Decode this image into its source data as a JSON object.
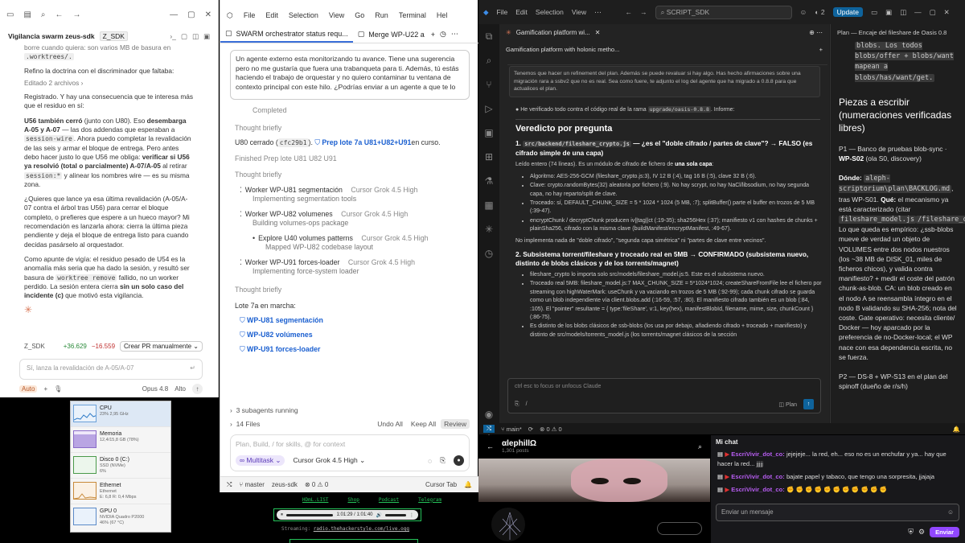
{
  "win1": {
    "title": "Vigilancia swarm zeus-sdk",
    "tag": "Z_SDK",
    "frag1": "borre cuando quiera: son varios MB de basura en",
    "frag2": ".worktrees/.",
    "p_refine": "Refino la doctrina con el discriminador que faltaba:",
    "edited": "Editado 2 archivos",
    "p_registrado": "Registrado. Y hay una consecuencia que te interesa más que el residuo en sí:",
    "u56_bold": "U56 también cerró",
    "u56_a": " (junto con U80). Eso ",
    "u56_b": "desembarga A-05 y A-07",
    "u56_c": " — las dos addendas que esperaban a ",
    "u56_code": "session-wire",
    "u56_d": ". Ahora puedo completar la revalidación de las seis y armar el bloque de entrega. Pero antes debo hacer justo lo que U56 me obliga: ",
    "u56_e": "verificar si U56 ya resolvió (total o parcialmente) A-07/A-05",
    "u56_f": " al retirar ",
    "u56_code2": "session:*",
    "u56_g": " y alinear los nombres wire — es su misma zona.",
    "p_quieres": "¿Quieres que lance ya esa última revalidación (A-05/A-07 contra el árbol tras U56) para cerrar el bloque completo, o prefieres que espere a un hueco mayor? Mi recomendación es lanzarla ahora: cierra la última pieza pendiente y deja el bloque de entrega listo para cuando decidas pasárselo al orquestador.",
    "vig_a": "Como apunte de vigía: el residuo pesado de U54 es la anomalía más seria que ha dado la sesión, y resultó ser basura de ",
    "vig_code": "worktree remove",
    "vig_b": " fallido, no un worker perdido. La sesión entera cierra ",
    "vig_c": "sin un solo caso del incidente (c)",
    "vig_d": " que motivó esta vigilancia.",
    "pr_tag": "Z_SDK",
    "pr_add": "+36.629",
    "pr_del": "−16.559",
    "pr_btn": "Crear PR manualmente",
    "input_placeholder": "Sí, lanza la revalidación de A-05/A-07",
    "mode": "Auto",
    "model": "Opus 4.8",
    "effort": "Alto"
  },
  "tm": {
    "items": [
      {
        "label": "CPU",
        "sub": "23% 2,95 GHz"
      },
      {
        "label": "Memoria",
        "sub": "12,4/15,8 GB (78%)"
      },
      {
        "label": "Disco 0 (C:)",
        "sub": "SSD (NVMe)\n6%"
      },
      {
        "label": "Ethernet",
        "sub": "Ethernet\nE: 6,8 R: 0,4 Mbps"
      },
      {
        "label": "GPU 0",
        "sub": "NVIDIA Quadro P2000\n46% (67 °C)"
      }
    ]
  },
  "win2": {
    "menu": [
      "File",
      "Edit",
      "Selection",
      "View",
      "Go",
      "Run",
      "Terminal",
      "Hel"
    ],
    "tab1": "SWARM orchestrator status requ...",
    "tab2": "Merge WP-U22 a",
    "sugg": "Un agente externo esta monitorizando tu avance. Tiene una sugerencia pero no me gustaría que fuera una trabanqueta para ti. Además, tú estás haciendo el trabajo de orquestar y no quiero contaminar tu ventana de contexto principal con este hilo. ¿Podrías enviar a un agente a que te lo",
    "completed": "Completed",
    "thought": "Thought",
    "briefly": "briefly",
    "u80": "U80 cerrado (",
    "u80_code": "cfc29b1",
    "u80_close": ").",
    "prep": "Prep lote 7a U81+U82+U91",
    "prep_tail": " en curso.",
    "finished_a": "Finished",
    "finished_b": "Prep lote U81 U82 U91",
    "agents": [
      {
        "title": "Worker WP-U81 segmentación",
        "model": "Cursor Grok 4.5 High",
        "sub": "Implementing segmentation tools"
      },
      {
        "title": "Worker WP-U82 volumenes",
        "model": "Cursor Grok 4.5 High",
        "sub": "Building volumes-ops package"
      },
      {
        "title": "Explore U40 volumes patterns",
        "model": "Cursor Grok 4.5 High",
        "sub": "Mapped WP-U82 codebase layout"
      },
      {
        "title": "Worker WP-U91 forces-loader",
        "model": "Cursor Grok 4.5 High",
        "sub": "Implementing force-system loader"
      }
    ],
    "lote": "Lote 7a en marcha:",
    "lote_items": [
      "WP-U81 segmentación",
      "WP-U82 volúmenes",
      "WP-U91 forces-loader"
    ],
    "subagents": "3 subagents running",
    "files": "14 Files",
    "undo": "Undo All",
    "keep": "Keep All",
    "review": "Review",
    "prompt_placeholder": "Plan, Build, / for skills, @ for context",
    "mode": "Multitask",
    "model": "Cursor Grok 4.5 High",
    "status": [
      "master",
      "zeus-sdk",
      "0",
      "0",
      "Cursor Tab"
    ]
  },
  "win3": {
    "menu": [
      "File",
      "Edit",
      "Selection",
      "View"
    ],
    "search": "SCRIPT_SDK",
    "update": "Update",
    "tab": "Gamification platform wi...",
    "heading": "Gamification platform with holonic metho...",
    "intro": "Tenemos que hacer un refinement del plan. Además se puede revaluar si hay algo. Has hecho afirmaciones sobre una migración rara a ssbv2 que no es real. Sea como fuere, te adjunto el log del agente que ha migrado a 0.8.8 para que actualices el plan.",
    "verified": "He verificado todo contra el código real de la rama ",
    "verified_code": "upgrade/oasis-0.8.8",
    "verified_b": ". Informe:",
    "veredicto": "Veredicto por pregunta",
    "q1_code": "src/backend/fileshare_crypto.js",
    "q1": " — ¿es el \"doble cifrado / partes de clave\"? → FALSO (es cifrado simple de una capa)",
    "q1_read": "Leído entero (74 líneas). Es un módulo de cifrado de fichero de ",
    "q1_read_b": "una sola capa",
    "q1_items": [
      "Algoritmo: AES-256-GCM (fileshare_crypto.js:3), IV 12 B (:4), tag 16 B (:5), clave 32 B (:6).",
      "Clave: crypto.randomBytes(32) aleatoria por fichero (:9). No hay scrypt, no hay NaCl/libsodium, no hay segunda capa, no hay reparto/split de clave.",
      "Troceado: sí, DEFAULT_CHUNK_SIZE = 5 * 1024 * 1024 (5 MB, :7); splitBuffer() parte el buffer en trozos de 5 MB (:39-47).",
      "encryptChunk / decryptChunk producen iv||tag||ct (:19-35); sha256Hex (:37); manifiesto v1 con hashes de chunks + plainSha256, cifrado con la misma clave (buildManifest/encryptManifest, :49-67)."
    ],
    "q1_foot": "No implementa nada de \"doble cifrado\", \"segunda capa simétrica\" ni \"partes de clave entre vecinos\".",
    "q2": "2. Subsistema torrent/fileshare y troceado real en 5MB → CONFIRMADO (subsistema nuevo, distinto de blobs clásicos y de los torrents/magnet)",
    "q2_items": [
      "fileshare_crypto lo importa solo src/models/fileshare_model.js:5. Este es el subsistema nuevo.",
      "Troceado real 5MB: fileshare_model.js:7 MAX_CHUNK_SIZE = 5*1024*1024; createShareFromFile lee el fichero por streaming con highWaterMark: useChunk y va vaciando en trozos de 5 MB (:92-99); cada chunk cifrado se guarda como un blob independiente vía client.blobs.add (:16-59, :57, :80). El manifiesto cifrado también es un blob (:84, :105). El \"pointer\" resultante = { type:'fileShare', v:1, key(hex), manifestBlobId, filename, mime, size, chunkCount } (:86-75).",
      "Es distinto de los blobs clásicos de ssb-blobs (los usa por debajo, añadiendo cifrado + troceado + manifiesto) y distinto de src/models/torrents_model.js (los torrents/magnet clásicos de la sección"
    ],
    "input_placeholder": "ctrl esc to focus or unfocus Claude",
    "plan": "Plan",
    "rhead": "Plan — Encaje del fileshare de Oasis 0.8",
    "r_top": "blobs. Los todos blobs/offer + blobs/want mapean a blobs/has/want/get.",
    "r_h": "Piezas a escribir (numeraciones verificadas libres)",
    "r_p1a": "P1 — Banco de pruebas blob-sync · ",
    "r_p1b": "WP-S02",
    "r_p1c": " (ola S0, discovery)",
    "r_donde": "Dónde: ",
    "r_code1": "aleph-scriptorium\\plan\\BACKLOG.md",
    "r_donde_b": ", tras WP-S01. ",
    "r_que": "Qué:",
    "r_que_b": " el mecanismo ya está caracterizado (citar ",
    "r_code2": "fileshare_model.js",
    "r_code3": "/fileshare_cry",
    "r_rest": "Lo que queda es empírico: ¿ssb-blobs mueve de verdad un objeto de VOLUMES entre dos nodos nuestros (los ~38 MB de DISK_01, miles de ficheros chicos), y valida contra manifiesto? + medir el coste del patrón chunk-as-blob. CA: un blob creado en el nodo A se reensambla íntegro en el nodo B validando su SHA-256; nota del coste. Gate operativo: necesita cliente/ Docker — hoy aparcado por la preferencia de no-Docker-local; el WP nace con esa dependencia escrita, no se fuerza.",
    "r_p2": "P2 — DS-8 + WP-S13 en el plan del spinoff (dueño de r/s/h)",
    "status_branch": "main*",
    "status_errs": "0",
    "status_warn": "0"
  },
  "web": {
    "title": "αlephillΩ",
    "posts": "1,301 posts",
    "nav": [
      "HDmL.LIST",
      "Shop",
      "Podcast",
      "Telegram"
    ],
    "time": "1:01:29 / 1:01:40",
    "radio_a": "Streaming:",
    "radio_b": "radio.thehackerstyle.com/live.ogg"
  },
  "chat": {
    "title": "Mi chat",
    "msgs": [
      {
        "user": "EscriVivir_dot_co:",
        "text": " jejejeje... la red, eh... eso no es un enchufar y ya... hay que hacer la red... jjjjj"
      },
      {
        "user": "EscriVivir_dot_co:",
        "text": " bajate papel y tabaco, que tengo una sorpresita, jjajaja"
      },
      {
        "user": "EscriVivir_dot_co:",
        "text": " ✊ ✊ ✊ ✊ ✊ ✊ ✊ ✊ ✊ ✊ ✊"
      }
    ],
    "placeholder": "Enviar un mensaje",
    "send": "Enviar"
  }
}
